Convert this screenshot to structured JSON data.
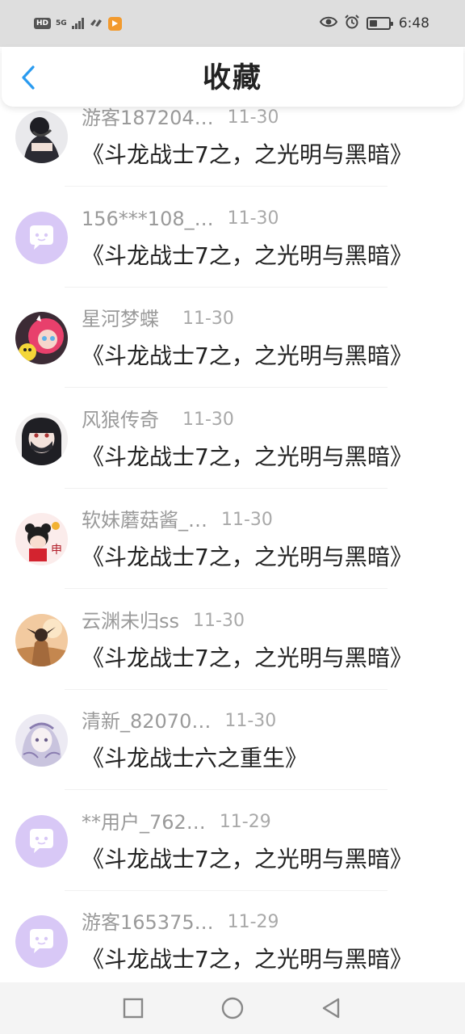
{
  "status_bar": {
    "hd_label": "HD",
    "network_label": "5G",
    "time": "6:48",
    "icons": [
      "hd-badge-icon",
      "signal-icon",
      "hotspot-icon",
      "app-notification-icon",
      "eye-icon",
      "alarm-icon",
      "battery-icon"
    ],
    "battery_level": 0.4
  },
  "header": {
    "title": "收藏",
    "back_icon": "chevron-left-icon",
    "accent_color": "#2a9bf0"
  },
  "favorites": [
    {
      "user": "游客187204…",
      "date": "11-30",
      "title": "《斗龙战士7之，之光明与黑暗》",
      "avatar": "photo-dark"
    },
    {
      "user": "156***108_…",
      "date": "11-30",
      "title": "《斗龙战士7之，之光明与黑暗》",
      "avatar": "default-chat"
    },
    {
      "user": "星河梦蝶",
      "date": "11-30",
      "title": "《斗龙战士7之，之光明与黑暗》",
      "avatar": "anime-pink"
    },
    {
      "user": "风狼传奇",
      "date": "11-30",
      "title": "《斗龙战士7之，之光明与黑暗》",
      "avatar": "anime-masked"
    },
    {
      "user": "软妹蘑菇酱_…",
      "date": "11-30",
      "title": "《斗龙战士7之，之光明与黑暗》",
      "avatar": "cartoon-red"
    },
    {
      "user": "云渊未归ss",
      "date": "11-30",
      "title": "《斗龙战士7之，之光明与黑暗》",
      "avatar": "anime-sunset"
    },
    {
      "user": "清新_82070…",
      "date": "11-30",
      "title": "《斗龙战士六之重生》",
      "avatar": "anime-purple"
    },
    {
      "user": "**用户_762…",
      "date": "11-29",
      "title": "《斗龙战士7之，之光明与黑暗》",
      "avatar": "default-chat"
    },
    {
      "user": "游客165375…",
      "date": "11-29",
      "title": "《斗龙战士7之，之光明与黑暗》",
      "avatar": "default-chat"
    }
  ],
  "colors": {
    "default_avatar": "#d8c8f6",
    "username": "#9a9a9a",
    "title_text": "#222222"
  },
  "system_nav": {
    "buttons": [
      "recent-apps-icon",
      "home-icon",
      "back-triangle-icon"
    ]
  }
}
